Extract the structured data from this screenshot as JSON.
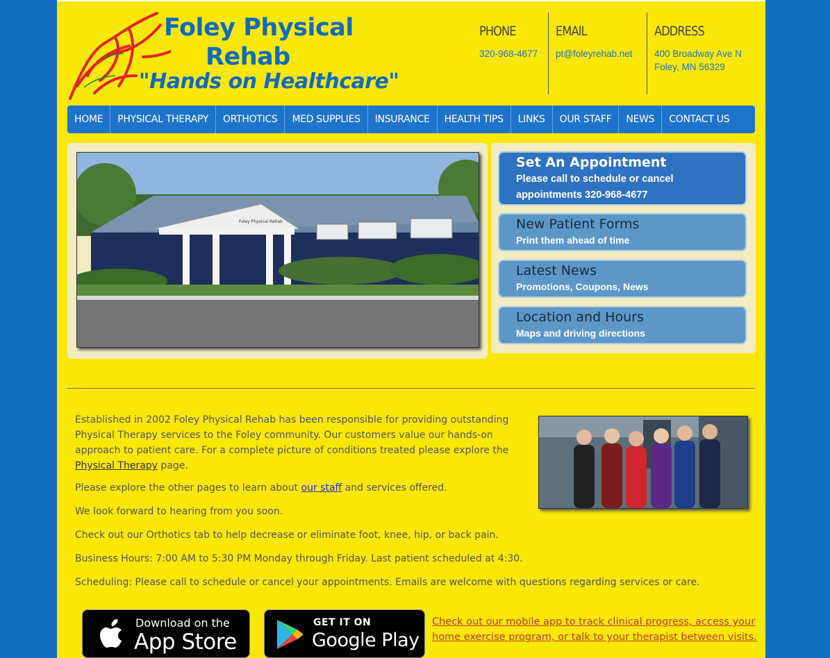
{
  "header": {
    "logo": {
      "line1": "Foley Physical",
      "line2": "Rehab",
      "tagline": "\"Hands on Healthcare\""
    },
    "contact": {
      "phone_label": "PHONE",
      "phone_value": "320-968-4677",
      "email_label": "EMAIL",
      "email_value": "pt@foleyrehab.net",
      "address_label": "ADDRESS",
      "address_line1": "400 Broadway Ave N",
      "address_line2": "Foley, MN 56329"
    }
  },
  "nav": {
    "items": [
      {
        "label": "HOME"
      },
      {
        "label": "PHYSICAL THERAPY"
      },
      {
        "label": "ORTHOTICS"
      },
      {
        "label": "MED SUPPLIES"
      },
      {
        "label": "INSURANCE"
      },
      {
        "label": "HEALTH TIPS"
      },
      {
        "label": "LINKS"
      },
      {
        "label": "OUR STAFF"
      },
      {
        "label": "NEWS"
      },
      {
        "label": "CONTACT US"
      }
    ]
  },
  "hero": {
    "sign_text": "Foley Physical Rehab",
    "cta": [
      {
        "title": "Set An Appointment",
        "subtitle": "Please call to schedule or cancel appointments 320-968-4677"
      },
      {
        "title": "New Patient Forms",
        "subtitle": "Print them ahead of time"
      },
      {
        "title": "Latest News",
        "subtitle": "Promotions, Coupons, News"
      },
      {
        "title": "Location and Hours",
        "subtitle": "Maps and driving directions"
      }
    ]
  },
  "content": {
    "intro_before_link": "Established in 2002 Foley Physical Rehab has been responsible for providing outstanding Physical Therapy services to the Foley community. Our customers value our hands-on approach to patient care. For a complete picture of conditions treated please explore the ",
    "intro_link": "Physical Therapy",
    "intro_after_link": " page.",
    "explore_before_link": "Please explore the other pages to learn about ",
    "explore_link": "our staff",
    "explore_after_link": " and services offered.",
    "look_forward": "We look forward to hearing from you soon.",
    "orthotics": "Check out our Orthotics tab to help decrease or eliminate foot, knee, hip, or back pain.",
    "hours": "Business Hours: 7:00 AM to 5:30 PM Monday through Friday. Last patient scheduled at 4:30.",
    "scheduling": "Scheduling: Please call to schedule or cancel your appointments. Emails are welcome with questions regarding services or care."
  },
  "apps": {
    "apple_small": "Download on the",
    "apple_big": "App Store",
    "google_small": "GET IT ON",
    "google_big": "Google Play",
    "link_text": "Check out our mobile app to track clinical progress, access your home exercise program, or talk to your therapist between visits."
  },
  "colors": {
    "page_background": "#f9e707",
    "outer_background": "#1170c4",
    "nav_background": "#1e74cc",
    "cta_primary": "#2f72c2",
    "cta_secondary": "#5c97c8",
    "divider": "#c0504d"
  }
}
